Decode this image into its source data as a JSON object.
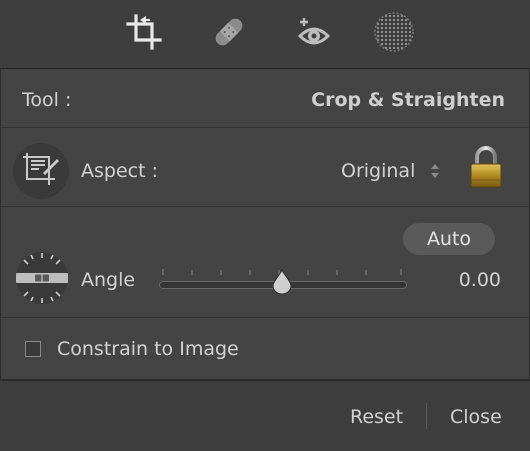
{
  "toolstrip": {
    "tools": [
      {
        "icon": "crop-icon",
        "active": true
      },
      {
        "icon": "bandage-icon",
        "active": false
      },
      {
        "icon": "red-eye-icon",
        "active": false
      },
      {
        "icon": "graduated-filter-icon",
        "active": false
      }
    ]
  },
  "tool_row": {
    "label": "Tool :",
    "value": "Crop & Straighten"
  },
  "aspect_row": {
    "label": "Aspect :",
    "value": "Original",
    "icon": "crop-frame-icon",
    "lock_icon": "lock-icon"
  },
  "angle_row": {
    "auto_label": "Auto",
    "label": "Angle",
    "value": "0.00",
    "icon": "level-icon",
    "slider_fraction": 0.5
  },
  "constrain": {
    "label": "Constrain to Image",
    "checked": false
  },
  "footer": {
    "reset_label": "Reset",
    "close_label": "Close"
  }
}
